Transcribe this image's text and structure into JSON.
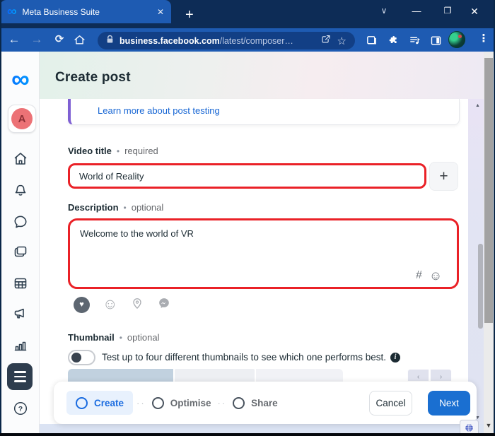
{
  "browser": {
    "tab": {
      "title": "Meta Business Suite",
      "favicon_glyph": "∞",
      "close_glyph": "✕",
      "new_tab_glyph": "+"
    },
    "window_controls": {
      "chevron": "∨",
      "minimize": "—",
      "maximize": "❐",
      "close": "✕"
    },
    "toolbar": {
      "back_glyph": "←",
      "forward_glyph": "→",
      "reload_glyph": "⟳",
      "url_domain": "business.facebook.com",
      "url_path": "/latest/composer…",
      "star_glyph": "☆",
      "kebab_glyph": "⋮"
    }
  },
  "sidebar": {
    "avatar_letter": "A",
    "logo_glyph": "∞"
  },
  "page": {
    "title": "Create post",
    "learn_more_link": "Learn more about post testing"
  },
  "form": {
    "video_title": {
      "label": "Video title",
      "separator": "•",
      "requirement": "required",
      "value": "World of Reality",
      "add_glyph": "+"
    },
    "description": {
      "label": "Description",
      "separator": "•",
      "requirement": "optional",
      "value": "Welcome to the world of VR",
      "hash_glyph": "#",
      "emoji_glyph": "☺"
    },
    "attachments": {
      "emoji_glyph": "☺",
      "heart_glyph": "♥"
    },
    "thumbnail": {
      "label": "Thumbnail",
      "separator": "•",
      "requirement": "optional",
      "help": "Test up to four different thumbnails to see which one performs best.",
      "info_glyph": "i",
      "prev_glyph": "‹",
      "next_glyph": "›"
    }
  },
  "footer": {
    "steps": [
      {
        "label": "Create"
      },
      {
        "label": "Optimise"
      },
      {
        "label": "Share"
      }
    ],
    "separator": "··",
    "cancel_label": "Cancel",
    "next_label": "Next"
  },
  "scroll": {
    "up_glyph": "▲",
    "down_glyph": "▼"
  },
  "colors": {
    "annotation_red": "#ea2127",
    "accent_blue": "#1b6ce0",
    "toolbar_blue": "#1e5bb2",
    "titlebar_navy": "#0d2c56",
    "purple_accent": "#7e5fd3"
  }
}
